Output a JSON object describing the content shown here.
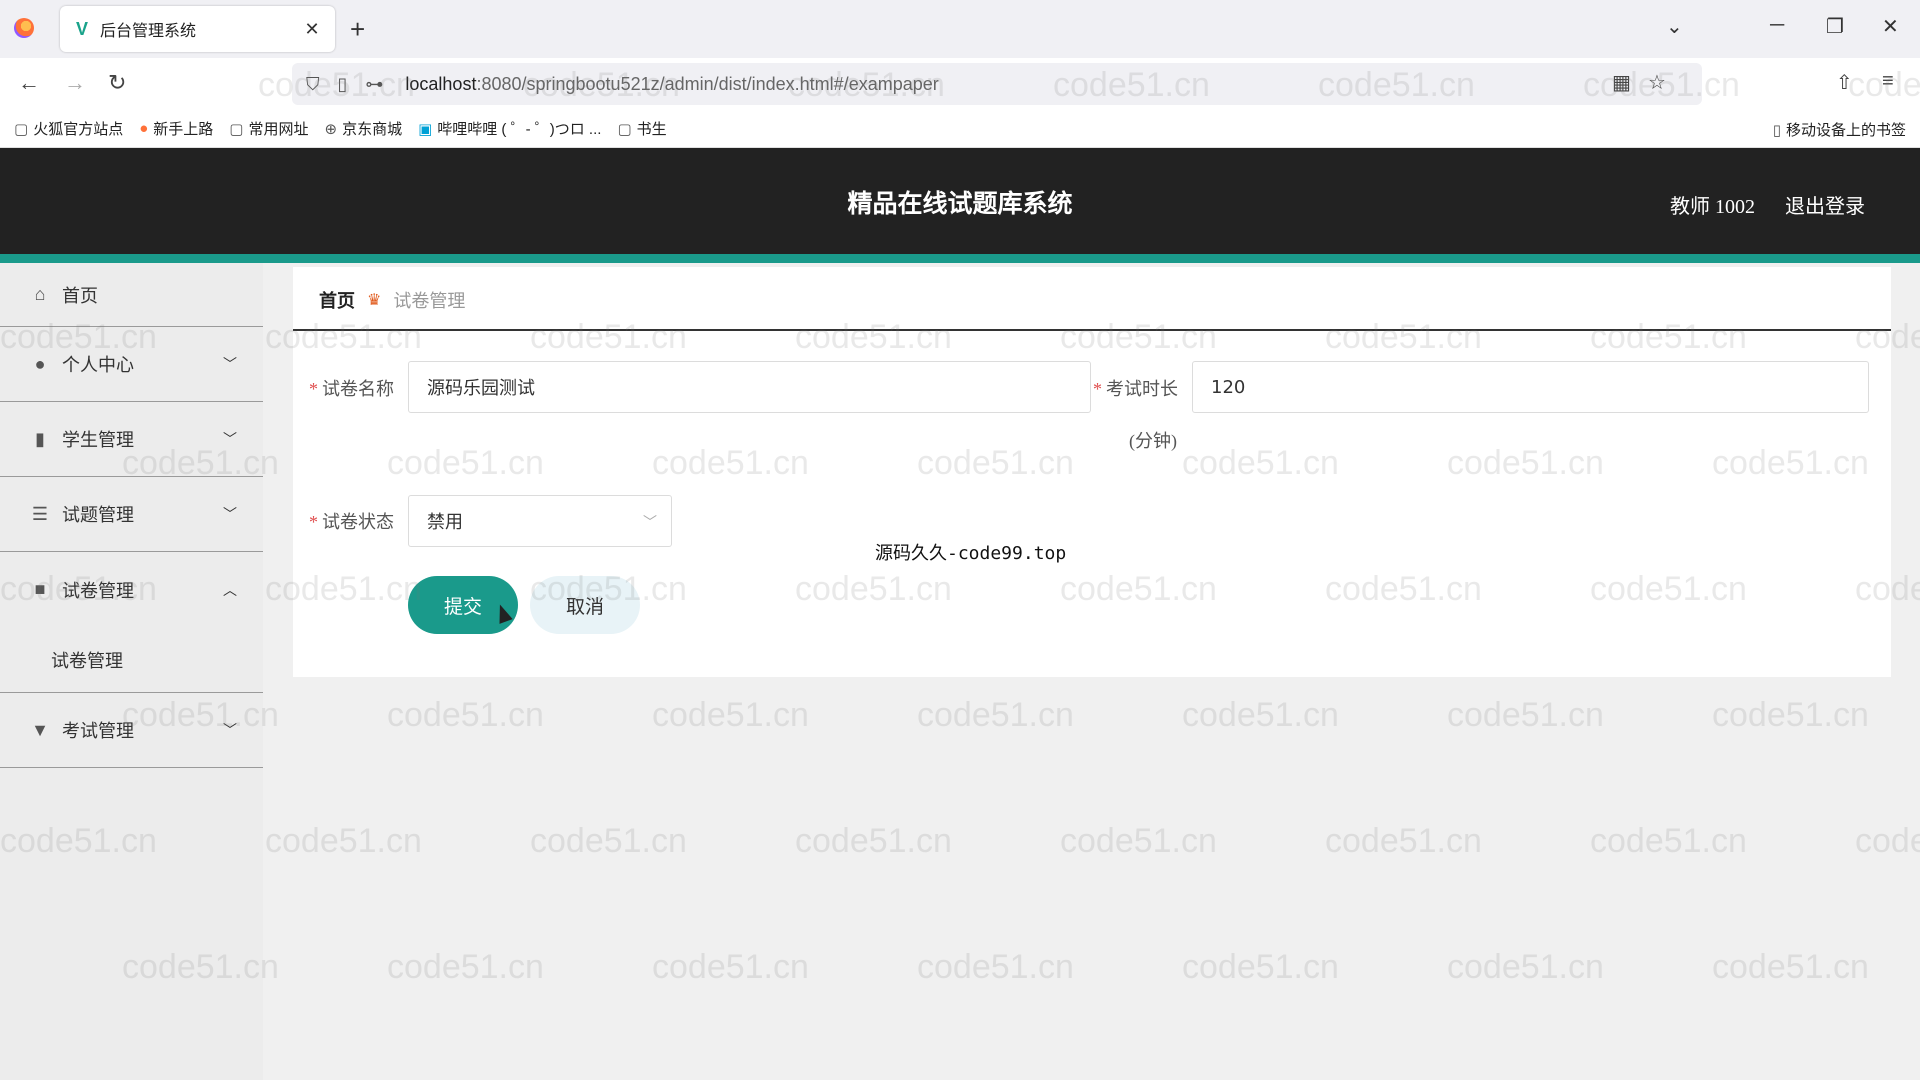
{
  "browser": {
    "tab_title": "后台管理系统",
    "tab_close": "✕",
    "new_tab": "+",
    "url_host": "localhost",
    "url_rest": ":8080/springbootu521z/admin/dist/index.html#/exampaper",
    "bookmarks": [
      "火狐官方站点",
      "新手上路",
      "常用网址",
      "京东商城",
      "哔哩哔哩 ( ゜- ゜)つロ ...",
      "书生"
    ],
    "mobile_bookmarks": "移动设备上的书签"
  },
  "header": {
    "title": "精品在线试题库系统",
    "user": "教师 1002",
    "logout": "退出登录"
  },
  "sidebar": {
    "items": [
      {
        "label": "首页",
        "icon": "home-icon"
      },
      {
        "label": "个人中心",
        "icon": "user-icon",
        "arrow": "﹀"
      },
      {
        "label": "学生管理",
        "icon": "book-icon",
        "arrow": "﹀"
      },
      {
        "label": "试题管理",
        "icon": "sliders-icon",
        "arrow": "﹀"
      },
      {
        "label": "试卷管理",
        "icon": "video-icon",
        "arrow": "︿"
      },
      {
        "label": "考试管理",
        "icon": "cup-icon",
        "arrow": "﹀"
      }
    ],
    "submenu": "试卷管理"
  },
  "breadcrumb": {
    "home": "首页",
    "current": "试卷管理"
  },
  "form": {
    "name_label": "试卷名称",
    "name_value": "源码乐园测试",
    "duration_label": "考试时长",
    "duration_value": "120",
    "duration_unit": "(分钟)",
    "status_label": "试卷状态",
    "status_value": "禁用",
    "required_mark": "*",
    "submit": "提交",
    "cancel": "取消"
  },
  "overlay_text": "源码久久-code99.top",
  "watermark": "code51.cn",
  "colors": {
    "accent": "#1a9a8b",
    "header_bg": "#222222",
    "required": "#e05050"
  }
}
